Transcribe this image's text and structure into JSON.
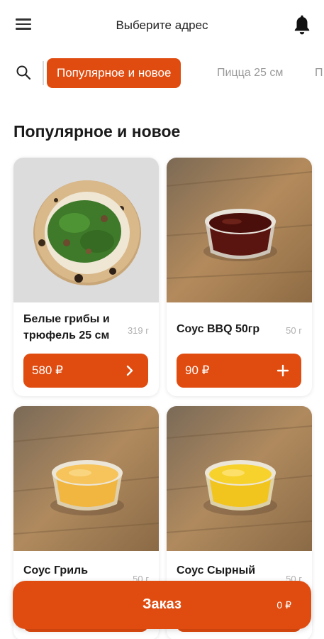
{
  "header": {
    "address": "Выберите адрес",
    "menu_icon": "menu-icon",
    "bell_icon": "bell-icon"
  },
  "categories": {
    "search_icon": "search-icon",
    "items": [
      {
        "label": "Популярное и новое",
        "active": true
      },
      {
        "label": "Пицца 25 см",
        "active": false
      },
      {
        "label": "П",
        "active": false
      }
    ]
  },
  "section": {
    "title": "Популярное и новое"
  },
  "products": [
    {
      "name": "Белые грибы и трюфель 25 см",
      "weight": "319 г",
      "price": "580 ₽",
      "button_icon": "chevron-right-icon"
    },
    {
      "name": "Соус BBQ 50гр",
      "weight": "50 г",
      "price": "90 ₽",
      "button_icon": "plus-icon"
    },
    {
      "name": "Соус Гриль",
      "weight": "50 г",
      "price": "",
      "button_icon": ""
    },
    {
      "name": "Соус Сырный",
      "weight": "50 г",
      "price": "",
      "button_icon": ""
    }
  ],
  "order": {
    "label": "Заказ",
    "total": "0 ₽"
  },
  "colors": {
    "accent": "#e04c10"
  }
}
